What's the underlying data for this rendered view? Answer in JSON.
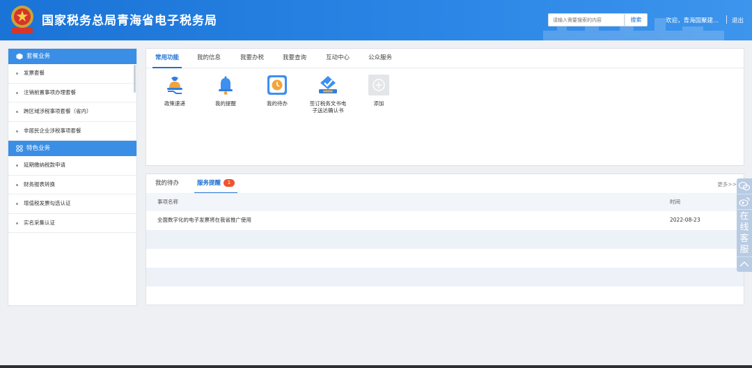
{
  "header": {
    "title": "国家税务总局青海省电子税务局",
    "search_placeholder": "请输入需要搜索的内容",
    "search_button": "搜索",
    "welcome": "欢迎，青海国聚建...",
    "logout": "退出"
  },
  "sidebar": {
    "section1": {
      "title": "套餐业务",
      "items": [
        "发票套餐",
        "注销前置事项办理套餐",
        "跨区域涉税事项套餐（省内）",
        "非居民企业涉税事项套餐"
      ]
    },
    "section2": {
      "title": "特色业务",
      "items": [
        "延期缴纳税款申请",
        "财务报表转换",
        "增值税发票勾选认证",
        "实名采集认证"
      ]
    }
  },
  "functions": {
    "tabs": [
      "常用功能",
      "我的信息",
      "我要办税",
      "我要查询",
      "互动中心",
      "公众服务"
    ],
    "active_tab": "常用功能",
    "items": [
      {
        "label": "政策速递",
        "icon": "policy-bell-icon"
      },
      {
        "label": "我的提醒",
        "icon": "reminder-bell-icon"
      },
      {
        "label": "我的待办",
        "icon": "clock-icon"
      },
      {
        "label": "签订税务文书电子送达确认书",
        "icon": "sign-document-icon"
      },
      {
        "label": "添加",
        "icon": "plus-icon"
      }
    ]
  },
  "notices": {
    "tabs": [
      "我的待办",
      "服务提醒"
    ],
    "active_tab": "服务提醒",
    "badge": "1",
    "more": "更多>>",
    "columns": [
      "事项名称",
      "时间"
    ],
    "rows": [
      {
        "name": "全面数字化的电子发票将在我省推广使用",
        "time": "2022-08-23"
      }
    ]
  },
  "float_bar": {
    "chat_label": "在线客服",
    "icons": [
      "wechat-icon",
      "weibo-icon",
      "back-to-top-icon"
    ]
  },
  "colors": {
    "header": "#1a73d6",
    "accent": "#1d6fd1",
    "sidebar_head": "#3a8ee6",
    "badge": "#f0532f"
  }
}
